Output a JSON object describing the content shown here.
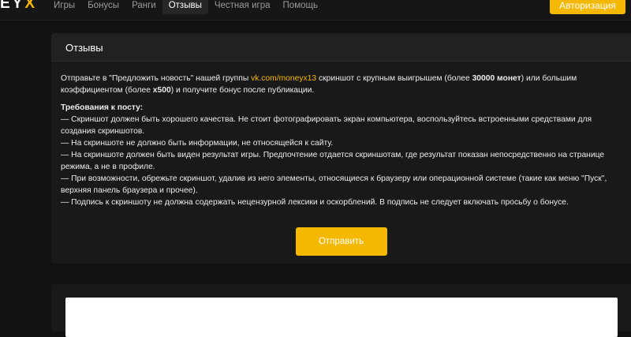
{
  "logo": {
    "text": "EY",
    "accent": "X"
  },
  "nav": {
    "items": [
      {
        "label": "Игры",
        "active": false
      },
      {
        "label": "Бонусы",
        "active": false
      },
      {
        "label": "Ранги",
        "active": false
      },
      {
        "label": "Отзывы",
        "active": true
      },
      {
        "label": "Честная игра",
        "active": false
      },
      {
        "label": "Помощь",
        "active": false
      }
    ],
    "auth_label": "Авторизация"
  },
  "reviews": {
    "title": "Отзывы",
    "intro": {
      "part1": "Отправьте в \"Предложить новость\" нашей группы ",
      "link": "vk.com/moneyx13",
      "part2": " скриншот с крупным выигрышем (более ",
      "bold1": "30000 монет",
      "part3": ") или большим коэффициентом (более ",
      "bold2": "x500",
      "part4": ") и получите бонус после публикации."
    },
    "requirements_title": "Требования к посту:",
    "requirements": [
      "— Скриншот должен быть хорошего качества. Не стоит фотографировать экран компьютера, воспользуйтесь встроенными средствами для создания скриншотов.",
      "— На скриншоте не должно быть информации, не относящейся к сайту.",
      "— На скриншоте должен быть виден результат игры. Предпочтение отдается скриншотам, где результат показан непосредственно на странице режима, а не в профиле.",
      "— При возможности, обрежьте скриншот, удалив из него элементы, относящиеся к браузеру или операционной системе (такие как меню \"Пуск\", верхняя панель браузера и прочее).",
      "— Подпись к скриншоту не должна содержать нецензурной лексики и оскорблений. В подпись не следует включать просьбу о бонусе."
    ],
    "submit_label": "Отправить"
  },
  "colors": {
    "accent": "#f5b800",
    "background": "#121212",
    "card": "#191919"
  }
}
